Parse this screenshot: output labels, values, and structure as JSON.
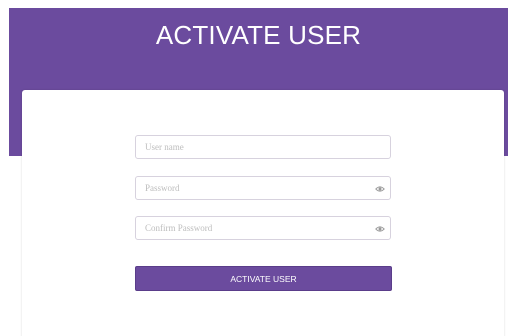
{
  "header": {
    "title": "ACTIVATE USER"
  },
  "form": {
    "username": {
      "placeholder": "User name",
      "value": ""
    },
    "password": {
      "placeholder": "Password",
      "value": "",
      "icon": "eye-icon"
    },
    "confirm_password": {
      "placeholder": "Confirm Password",
      "value": "",
      "icon": "eye-icon"
    },
    "submit_label": "ACTIVATE USER"
  },
  "colors": {
    "accent": "#6b4b9e",
    "page_background": "#ffffff"
  }
}
